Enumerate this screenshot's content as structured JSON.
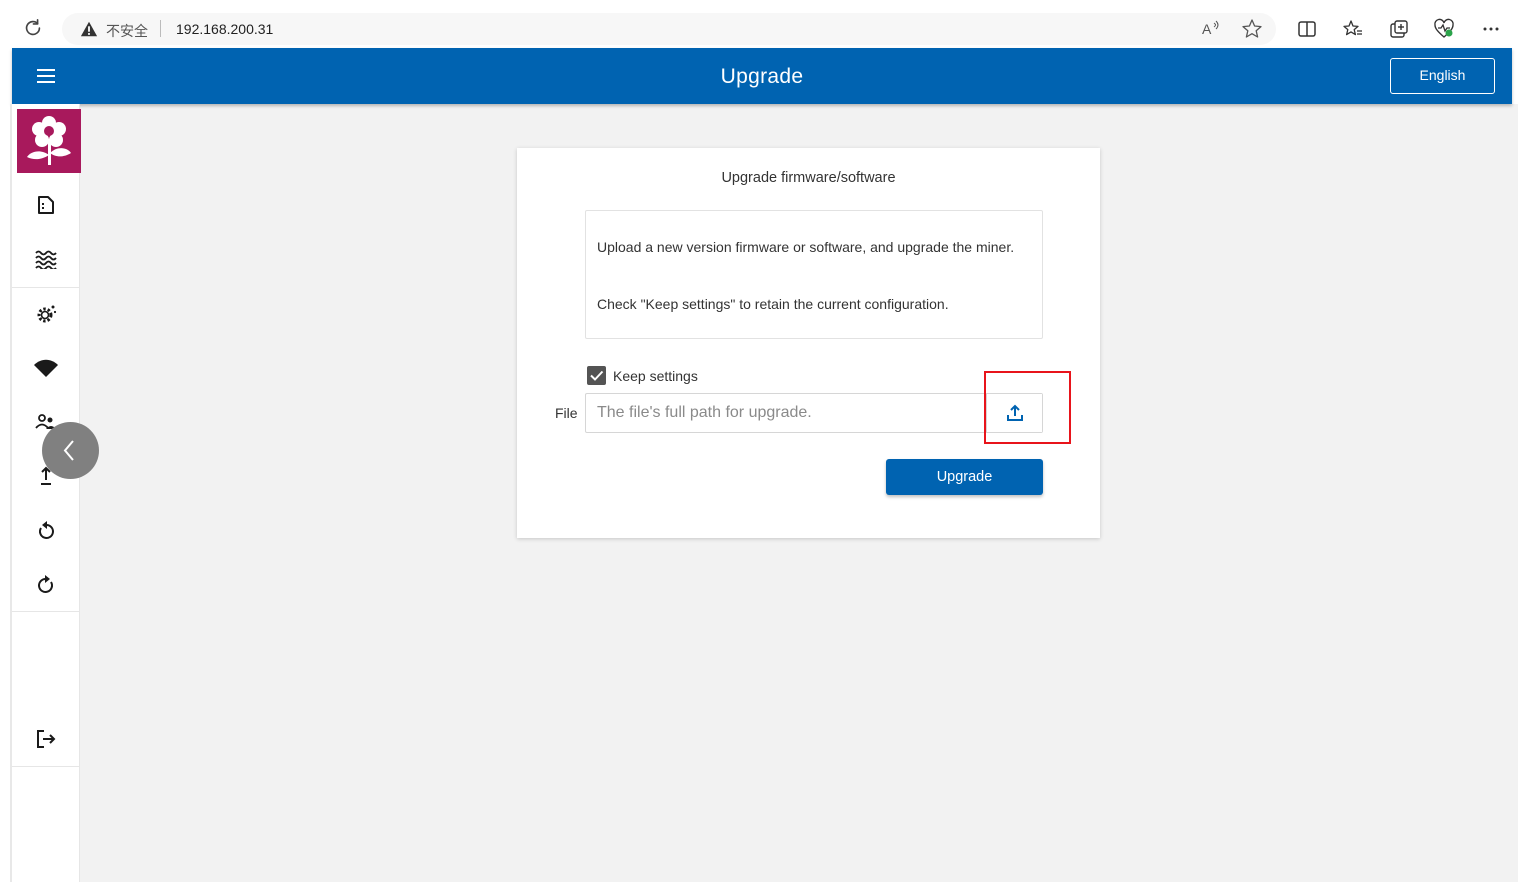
{
  "browser": {
    "insecure_label": "不安全",
    "url": "192.168.200.31"
  },
  "header": {
    "title": "Upgrade",
    "language_button": "English"
  },
  "sidebar": {
    "items": [
      {
        "icon": "document-icon"
      },
      {
        "icon": "waves-icon"
      },
      {
        "icon": "settings-gear-icon"
      },
      {
        "icon": "wifi-icon"
      },
      {
        "icon": "users-icon"
      },
      {
        "icon": "upload-arrow-icon"
      },
      {
        "icon": "rotate-left-icon"
      },
      {
        "icon": "refresh-icon"
      },
      {
        "icon": "logout-icon"
      }
    ]
  },
  "card": {
    "title": "Upgrade firmware/software",
    "info_line1": "Upload a new version firmware or software, and upgrade the miner.",
    "info_line2": "Check \"Keep settings\" to retain the current configuration.",
    "keep_settings_label": "Keep settings",
    "keep_settings_checked": true,
    "file_label": "File",
    "file_placeholder": "The file's full path for upgrade.",
    "upgrade_button": "Upgrade"
  },
  "colors": {
    "header_bg": "#0063b1",
    "logo_bg": "#a8195c",
    "highlight": "#e8141b",
    "content_bg": "#f2f2f2"
  }
}
